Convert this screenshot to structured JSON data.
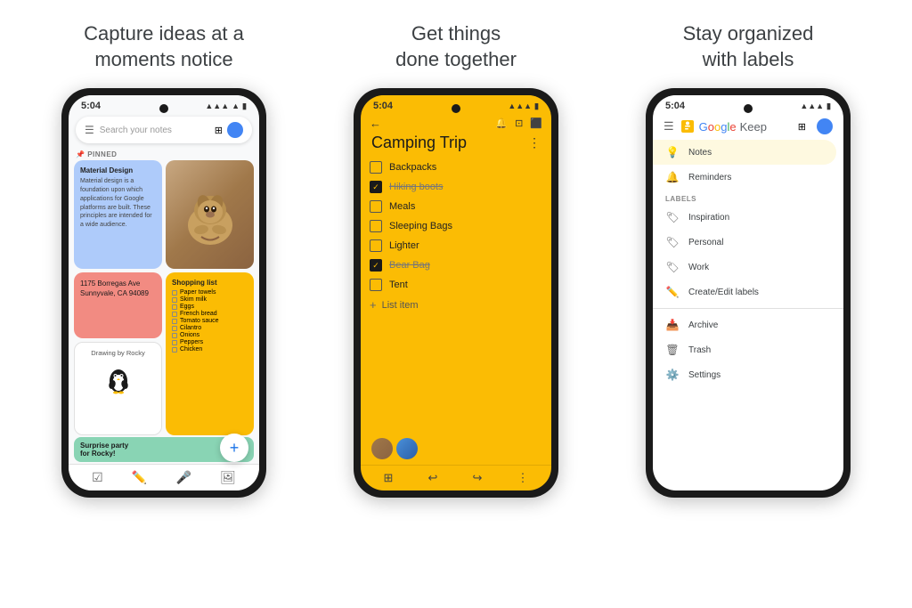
{
  "columns": [
    {
      "id": "col1",
      "title": "Capture ideas at a\nmoments notice",
      "phone": {
        "time": "5:04",
        "search_placeholder": "Search your notes",
        "pinned_label": "PINNED",
        "notes": [
          {
            "id": "material-design",
            "color": "blue",
            "title": "Material Design",
            "body": "Material design is a foundation upon which applications for Google platforms are built. These principles are intended for a wide audience."
          },
          {
            "id": "dog-photo",
            "color": "photo",
            "title": ""
          },
          {
            "id": "address",
            "color": "pink",
            "title": "",
            "body": "1175 Borregas Ave Sunnyvale, CA 94089"
          },
          {
            "id": "shopping",
            "color": "yellow",
            "title": "Shopping list",
            "items": [
              "Paper towels",
              "Skim milk",
              "Eggs",
              "French bread",
              "Tomato sauce",
              "Cilantro",
              "Onions",
              "Peppers",
              "Chicken"
            ]
          },
          {
            "id": "drawing",
            "color": "white",
            "title": "Drawing by Rocky"
          },
          {
            "id": "surprise",
            "color": "teal",
            "title": "Surprise party\nfor Rocky!"
          }
        ]
      }
    },
    {
      "id": "col2",
      "title": "Get things\ndone together",
      "phone": {
        "time": "5:04",
        "note_title": "Camping Trip",
        "items": [
          {
            "text": "Backpacks",
            "checked": false
          },
          {
            "text": "Hiking boots",
            "checked": true
          },
          {
            "text": "Meals",
            "checked": false
          },
          {
            "text": "Sleeping Bags",
            "checked": false
          },
          {
            "text": "Lighter",
            "checked": false
          },
          {
            "text": "Bear Bag",
            "checked": true
          },
          {
            "text": "Tent",
            "checked": false
          }
        ],
        "add_label": "List item"
      }
    },
    {
      "id": "col3",
      "title": "Stay organized\nwith labels",
      "phone": {
        "time": "5:04",
        "app_name": "Google Keep",
        "menu_items": [
          {
            "label": "Notes",
            "icon": "bulb",
            "active": true
          },
          {
            "label": "Reminders",
            "icon": "bell",
            "active": false
          }
        ],
        "section_label": "LABELS",
        "label_items": [
          {
            "label": "Inspiration",
            "icon": "label"
          },
          {
            "label": "Personal",
            "icon": "label"
          },
          {
            "label": "Work",
            "icon": "label"
          },
          {
            "label": "Create/Edit labels",
            "icon": "pencil"
          }
        ],
        "other_items": [
          {
            "label": "Archive",
            "icon": "archive"
          },
          {
            "label": "Trash",
            "icon": "trash"
          },
          {
            "label": "Settings",
            "icon": "settings"
          }
        ]
      }
    }
  ]
}
